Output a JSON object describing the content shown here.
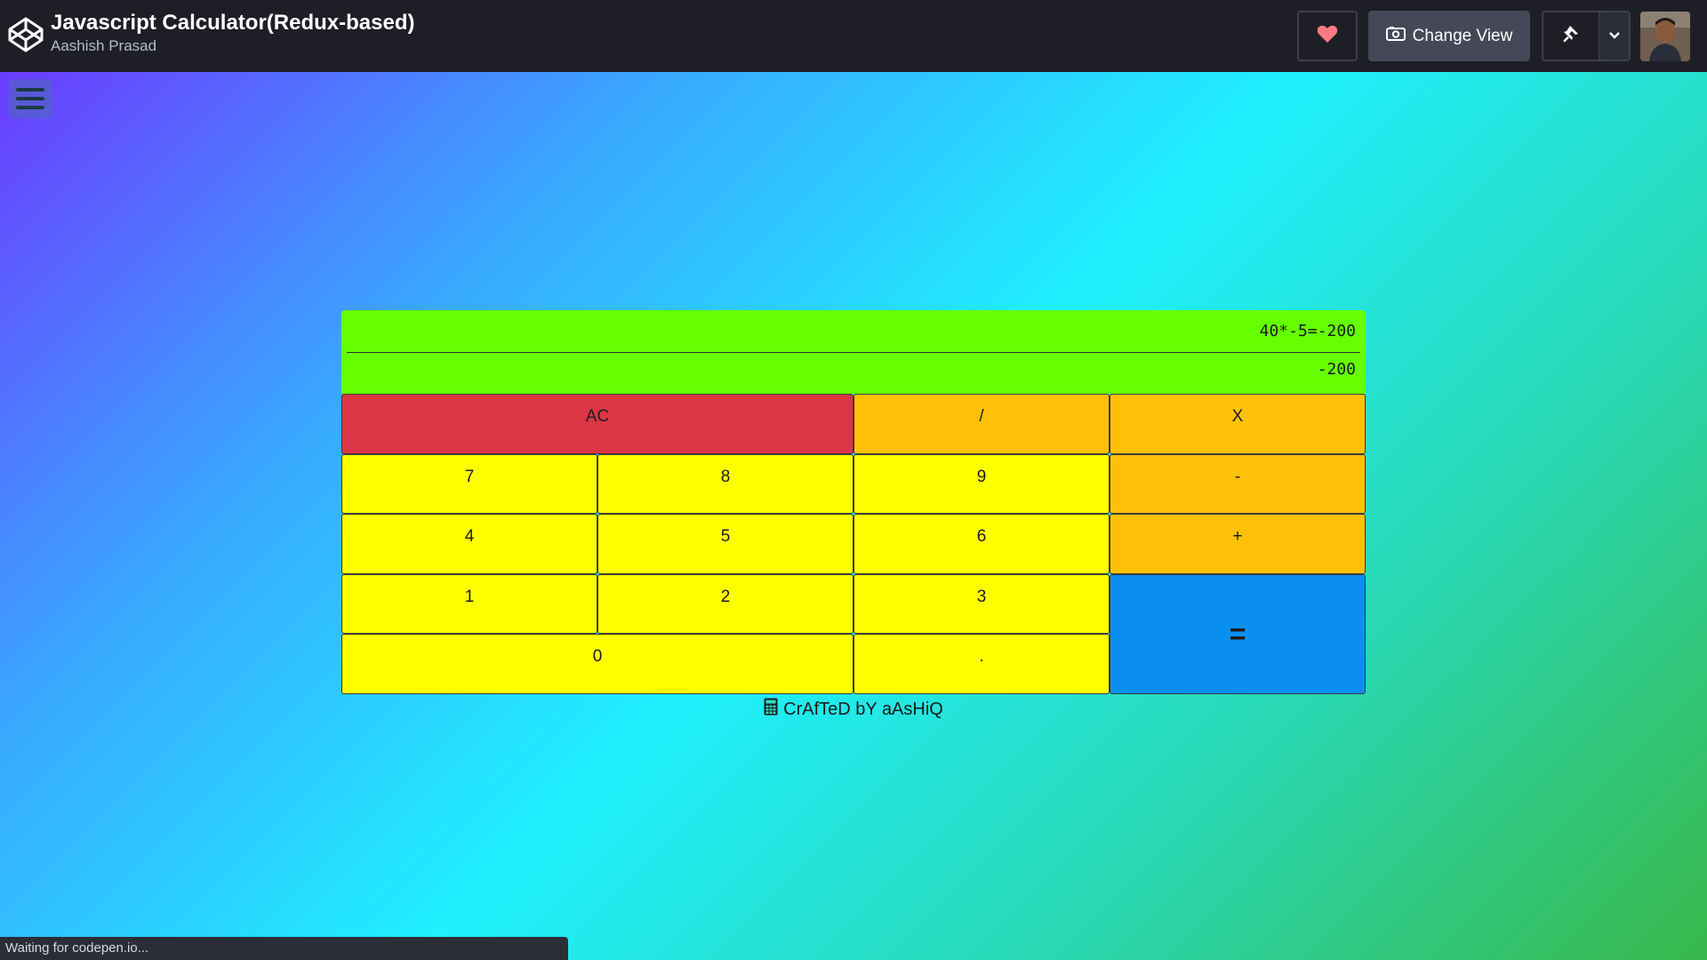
{
  "header": {
    "title": "Javascript Calculator(Redux-based)",
    "author": "Aashish Prasad",
    "logo_icon": "codepen-logo-icon",
    "heart_icon": "heart-icon",
    "heart_color": "#ff7a85",
    "change_view_label": "Change View",
    "change_view_icon": "eye-icon",
    "pin_icon": "pin-icon",
    "dropdown_icon": "chevron-down-icon"
  },
  "menu": {
    "icon": "hamburger-icon"
  },
  "calculator": {
    "formula": "40*-5=-200",
    "output": "-200",
    "keys": {
      "clear": "AC",
      "divide": "/",
      "multiply": "X",
      "seven": "7",
      "eight": "8",
      "nine": "9",
      "subtract": "-",
      "four": "4",
      "five": "5",
      "six": "6",
      "add": "+",
      "one": "1",
      "two": "2",
      "three": "3",
      "equals": "=",
      "zero": "0",
      "decimal": "."
    },
    "colors": {
      "display": "#66ff00",
      "clear": "#dc3545",
      "operator": "#ffc107",
      "number": "#ffff00",
      "equals": "#0a8ff0"
    }
  },
  "footer": {
    "credit": "CrAfTeD bY aAsHiQ",
    "credit_icon": "calculator-icon"
  },
  "status": {
    "text": "Waiting for codepen.io..."
  }
}
